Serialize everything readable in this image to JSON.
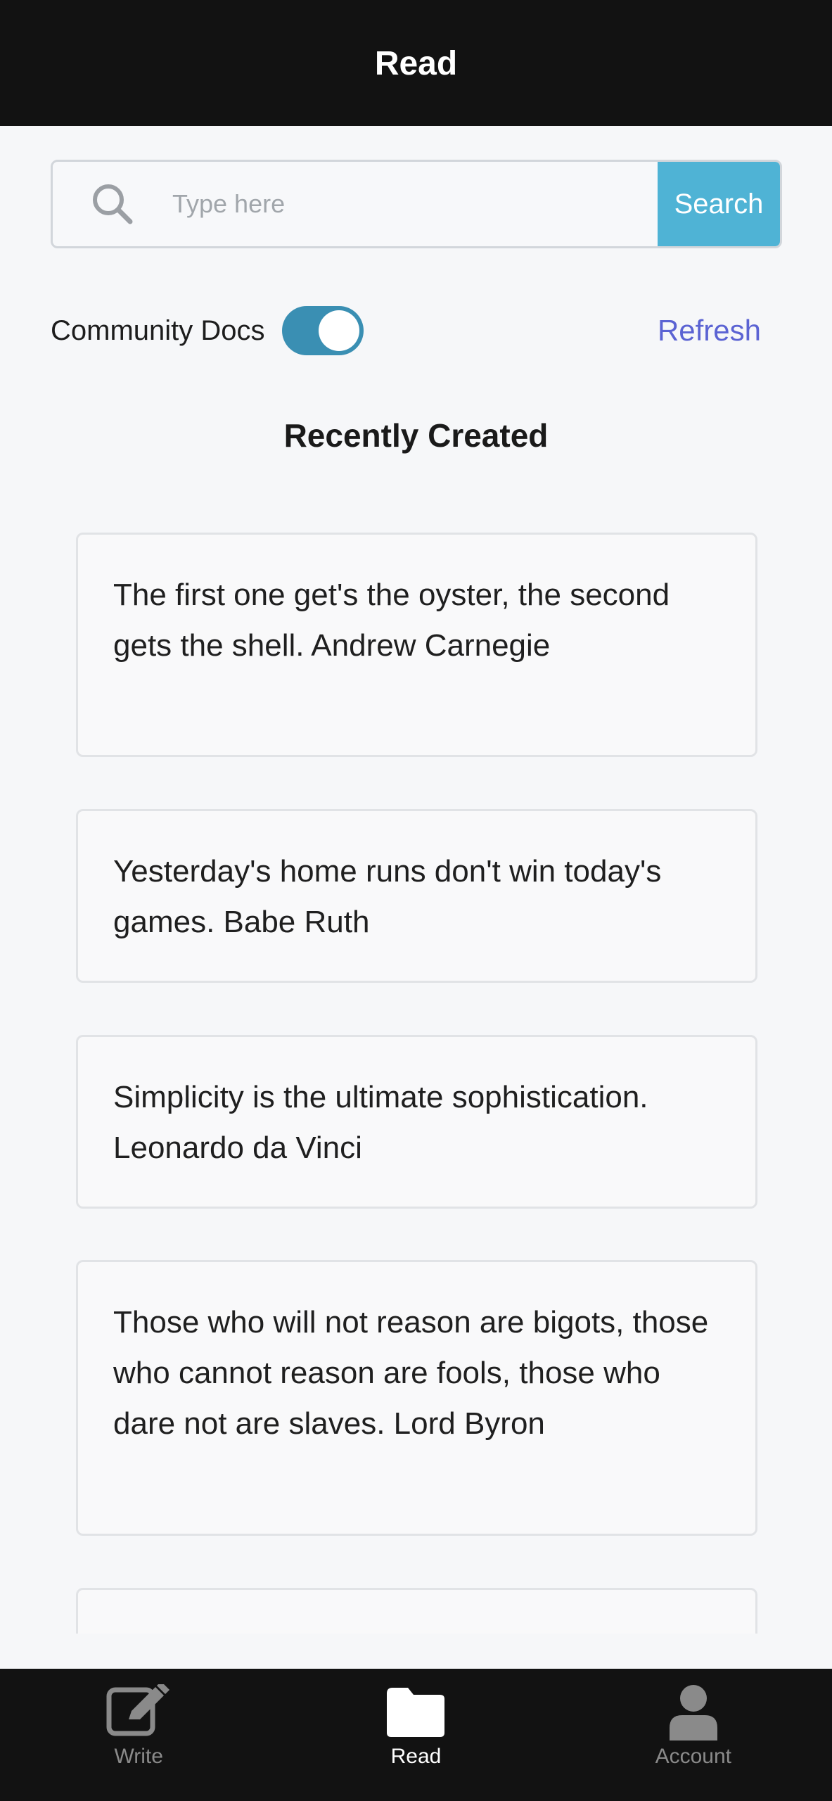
{
  "header": {
    "title": "Read"
  },
  "search": {
    "placeholder": "Type here",
    "value": "",
    "button_label": "Search"
  },
  "controls": {
    "toggle_label": "Community Docs",
    "toggle_on": true,
    "refresh_label": "Refresh"
  },
  "section": {
    "title": "Recently Created"
  },
  "documents": [
    {
      "text": "The first one get's the oyster, the second gets the shell. Andrew Carnegie"
    },
    {
      "text": "Yesterday's home runs don't win today's games. Babe Ruth"
    },
    {
      "text": "Simplicity is the ultimate sophistication. Leonardo da Vinci"
    },
    {
      "text": "Those who will not reason are bigots, those who cannot reason are fools, those who dare not are slaves. Lord Byron"
    },
    {
      "text": ""
    }
  ],
  "tabs": [
    {
      "label": "Write",
      "icon": "edit-icon",
      "active": false
    },
    {
      "label": "Read",
      "icon": "folder-icon",
      "active": true
    },
    {
      "label": "Account",
      "icon": "user-icon",
      "active": false
    }
  ],
  "colors": {
    "header_bg": "#121212",
    "search_button": "#4fb3d5",
    "toggle_on": "#3a8fb3",
    "refresh_link": "#5b63d3"
  }
}
